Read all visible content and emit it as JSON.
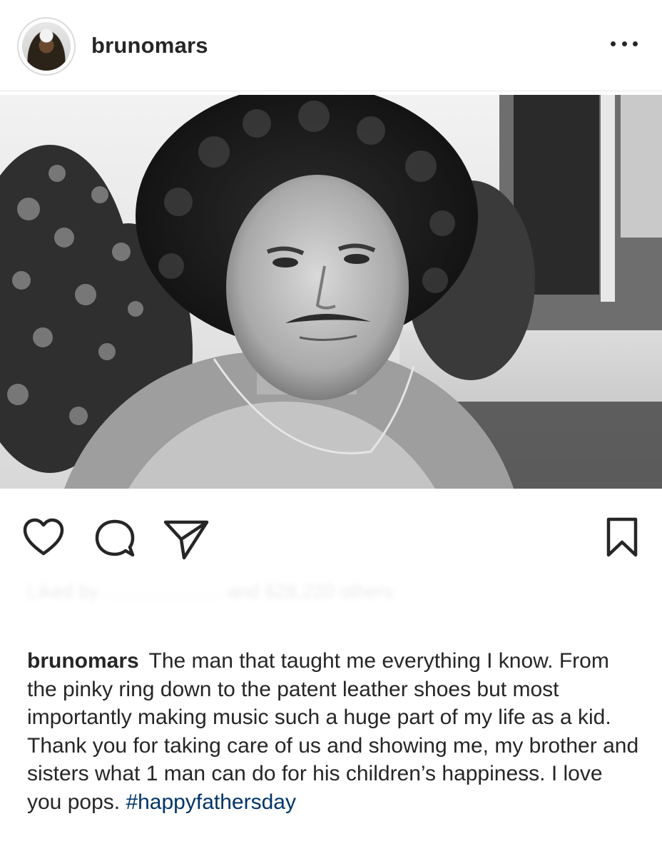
{
  "post": {
    "username": "brunomars",
    "avatar_icon": "profile-photo",
    "more_icon": "more-horizontal-icon",
    "likes_text": "Liked by ...................... and 628,220 others",
    "caption": {
      "username": "brunomars",
      "text": "The man that taught me everything I know. From the pinky ring down to the patent leather shoes but most importantly making music such a huge part of my life as a kid. Thank you for taking care of us and showing me, my brother and sisters what 1 man can do for his children’s happiness. I love you pops.",
      "hashtag": "#happyfathersday"
    }
  },
  "actions": {
    "like_icon": "heart-icon",
    "comment_icon": "comment-icon",
    "share_icon": "paper-plane-icon",
    "save_icon": "bookmark-icon"
  },
  "colors": {
    "text": "#262626",
    "hashtag": "#003569",
    "divider": "#e6e6e6"
  }
}
